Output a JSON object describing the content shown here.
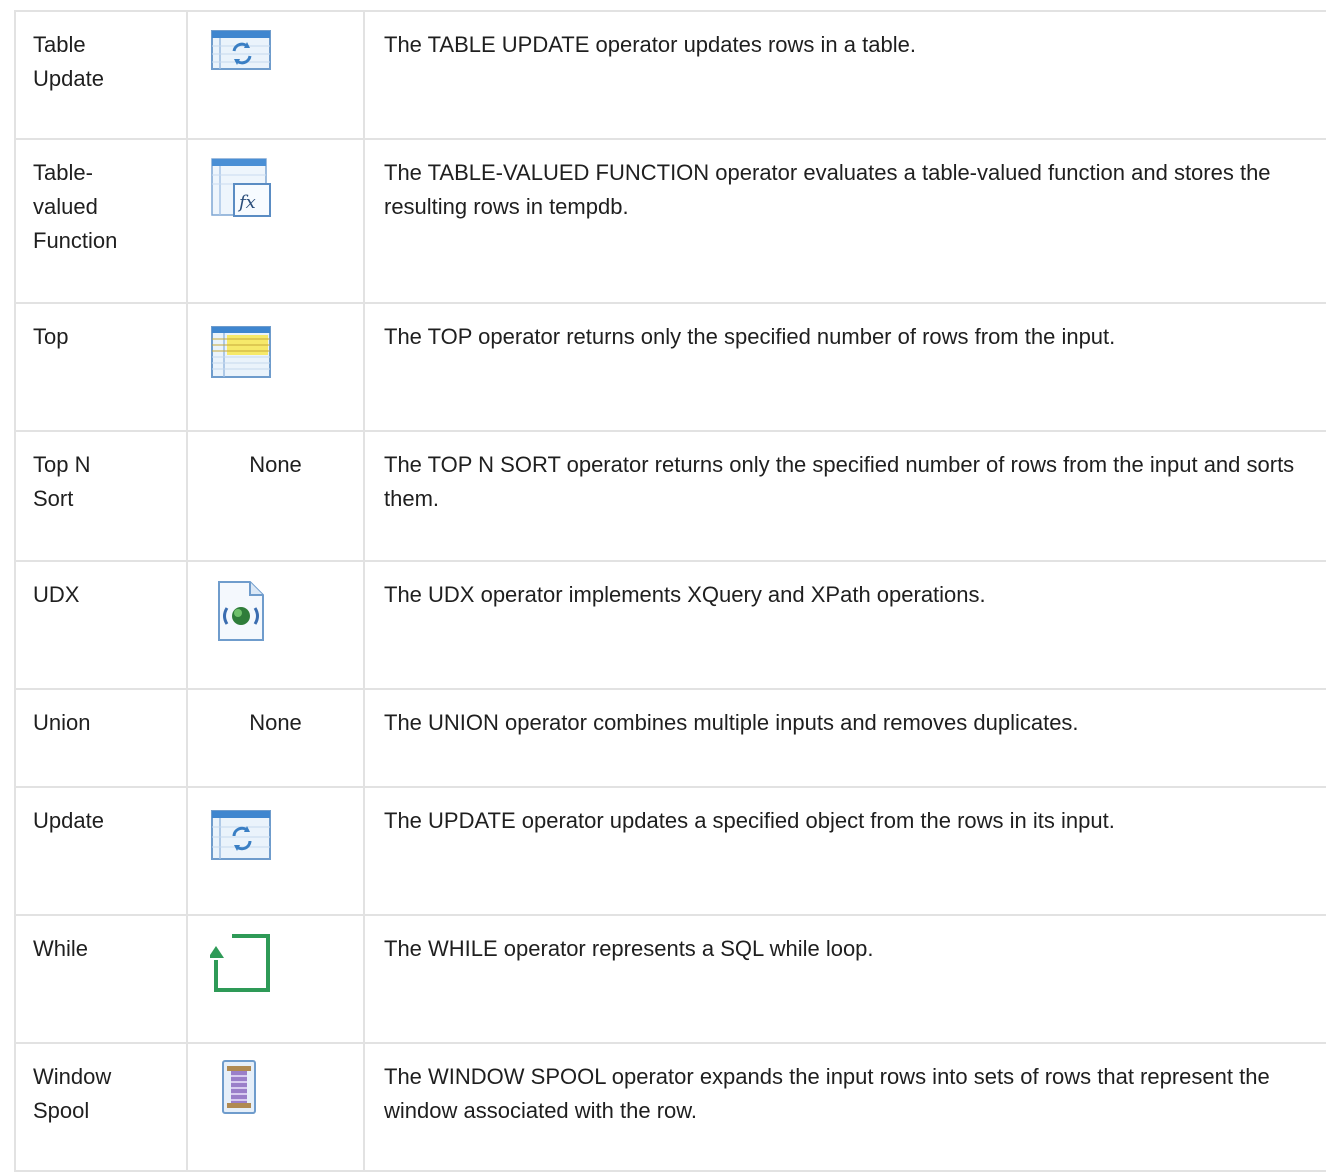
{
  "rows": [
    {
      "name": "Table\nUpdate",
      "icon": "table-update-icon",
      "icon_text": "",
      "description": "The TABLE UPDATE operator updates rows in a table."
    },
    {
      "name": "Table-\nvalued\nFunction",
      "icon": "table-valued-function-icon",
      "icon_text": "",
      "description": "The TABLE-VALUED FUNCTION operator evaluates a table-valued function and stores the resulting rows in tempdb."
    },
    {
      "name": "Top",
      "icon": "top-icon",
      "icon_text": "",
      "description": "The TOP operator returns only the specified number of rows from the input."
    },
    {
      "name": "Top N\nSort",
      "icon": "",
      "icon_text": "None",
      "description": "The TOP N SORT operator returns only the specified number of rows from the input and sorts them."
    },
    {
      "name": "UDX",
      "icon": "udx-icon",
      "icon_text": "",
      "description": "The UDX operator implements XQuery and XPath operations."
    },
    {
      "name": "Union",
      "icon": "",
      "icon_text": "None",
      "description": "The UNION operator combines multiple inputs and removes duplicates."
    },
    {
      "name": "Update",
      "icon": "update-icon",
      "icon_text": "",
      "description": "The UPDATE operator updates a specified object from the rows in its input."
    },
    {
      "name": "While",
      "icon": "while-loop-icon",
      "icon_text": "",
      "description": "The WHILE operator represents a SQL while loop."
    },
    {
      "name": "Window\nSpool",
      "icon": "window-spool-icon",
      "icon_text": "",
      "description": "The WINDOW SPOOL operator expands the input rows into sets of rows that represent the window associated with the row."
    }
  ]
}
